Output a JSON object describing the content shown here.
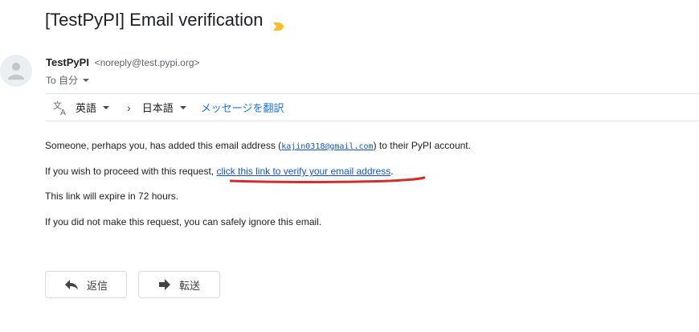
{
  "subject": "[TestPyPI] Email verification",
  "sender": {
    "name": "TestPyPI",
    "email": "<noreply@test.pypi.org>",
    "to_label": "To 自分"
  },
  "translate": {
    "source_lang": "英語",
    "target_lang": "日本語",
    "translate_link": "メッセージを翻訳"
  },
  "body": {
    "p1_before": "Someone, perhaps you, has added this email address (",
    "p1_email": "kajin0318@gmail.com",
    "p1_after": ") to their PyPI account.",
    "p2_before": "If you wish to proceed with this request, ",
    "p2_link": "click this link to verify your email address",
    "p2_after": ".",
    "p3": "This link will expire in 72 hours.",
    "p4": "If you did not make this request, you can safely ignore this email."
  },
  "actions": {
    "reply": "返信",
    "forward": "転送"
  },
  "colors": {
    "link": "#1155cc",
    "annotation": "#d32f2f",
    "importance": "#f6c026"
  }
}
